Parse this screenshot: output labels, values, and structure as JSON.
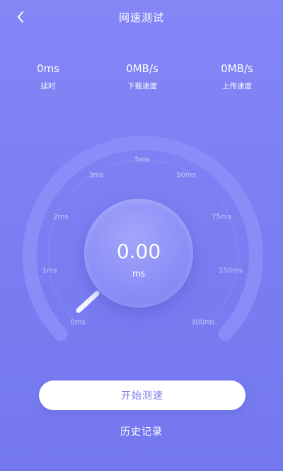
{
  "header": {
    "title": "网速测试",
    "back_icon": "chevron-left-icon"
  },
  "stats": [
    {
      "value": "0ms",
      "label": "延时"
    },
    {
      "value": "0MB/s",
      "label": "下载速度"
    },
    {
      "value": "0MB/s",
      "label": "上传速度"
    }
  ],
  "gauge": {
    "ticks": [
      "0ms",
      "1ms",
      "2ms",
      "3ms",
      "5ms",
      "50ms",
      "75ms",
      "150ms",
      "300ms"
    ],
    "reading": "0.00",
    "unit": "ms",
    "needle_value": 0
  },
  "actions": {
    "start_label": "开始测速",
    "history_label": "历史记录"
  }
}
